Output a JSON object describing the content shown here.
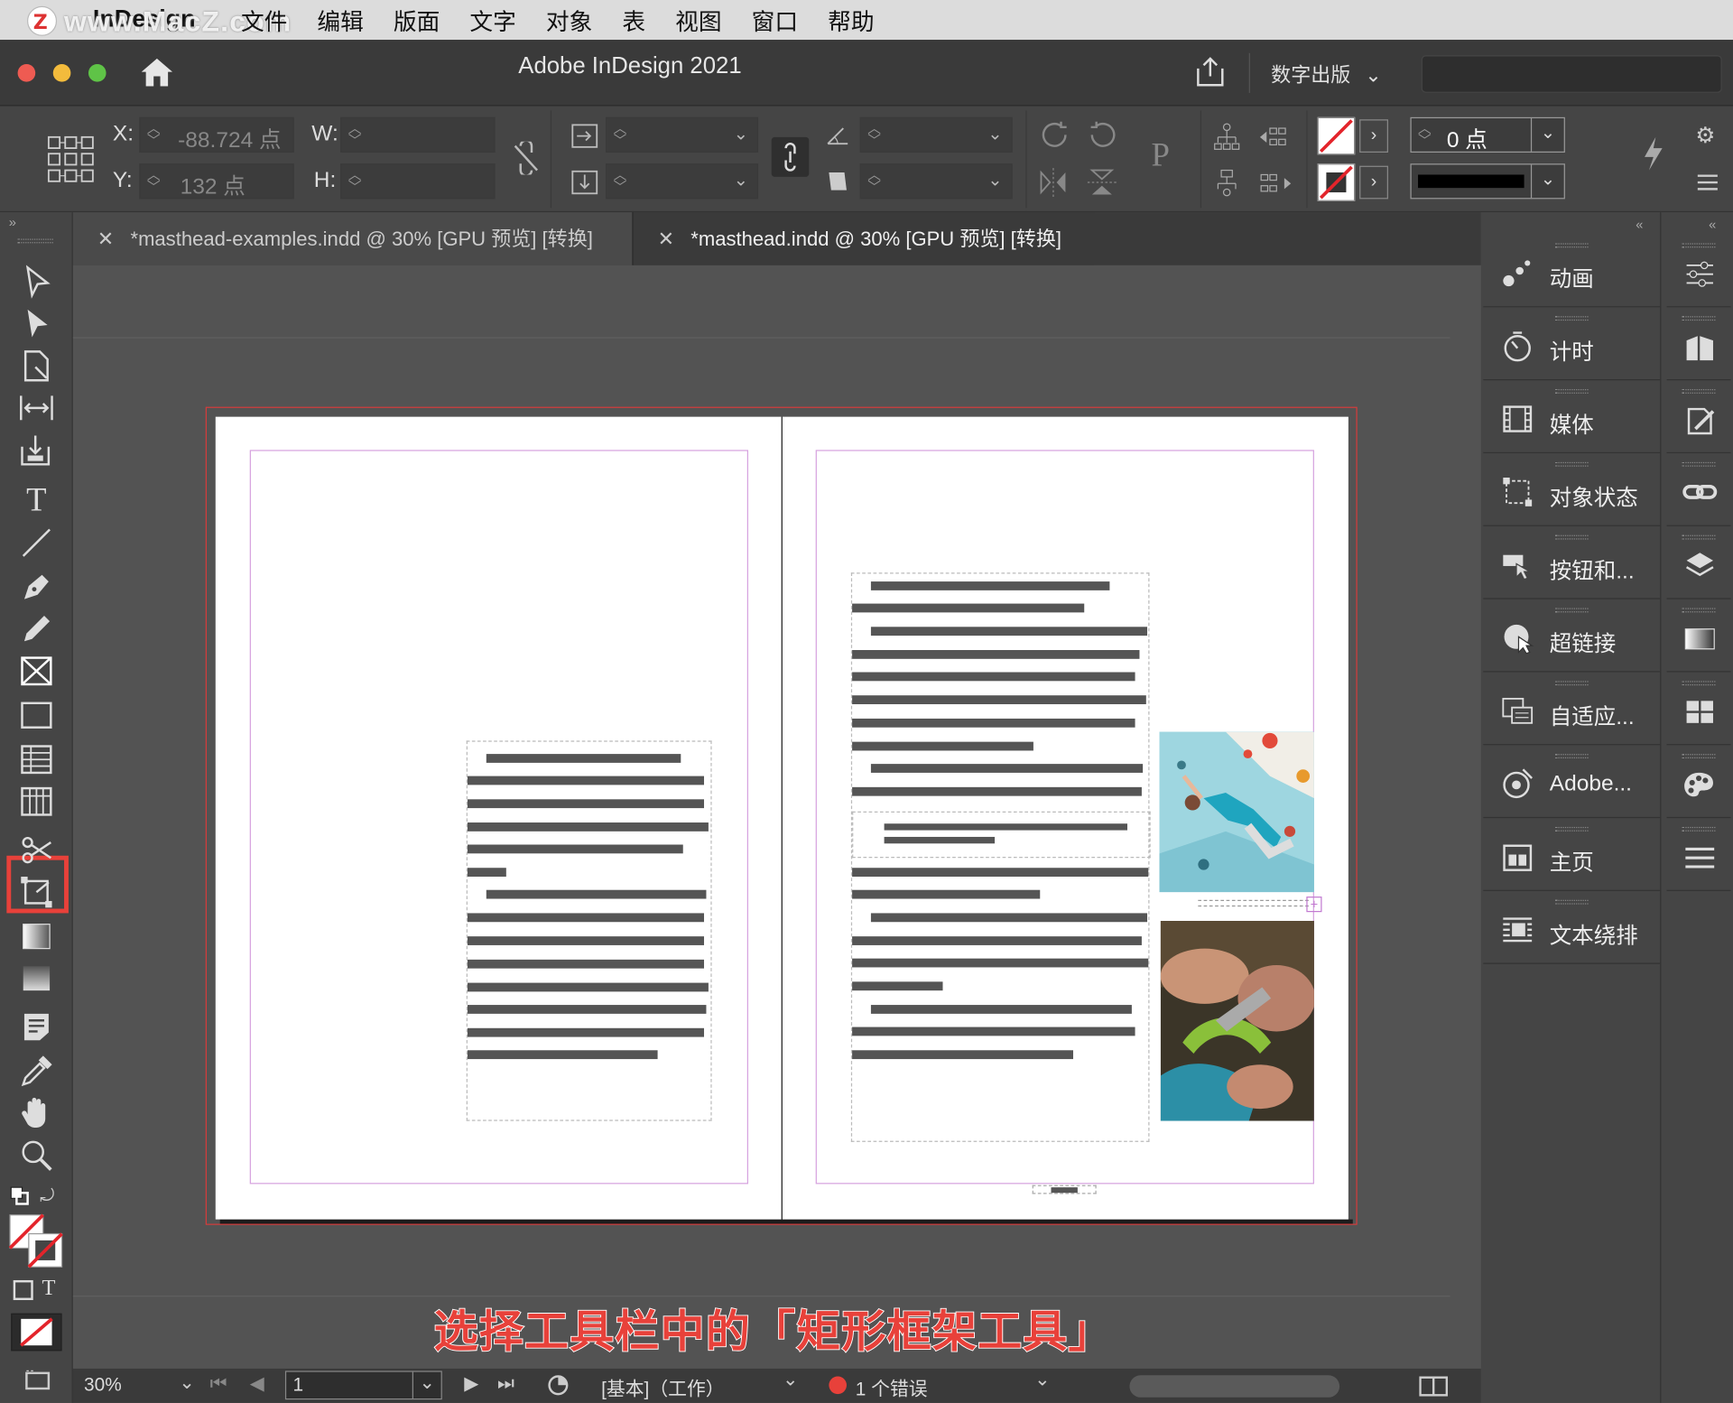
{
  "menubar": {
    "watermark": "www.MacZ.com",
    "app_name": "InDesign",
    "items": [
      "文件",
      "编辑",
      "版面",
      "文字",
      "对象",
      "表",
      "视图",
      "窗口",
      "帮助"
    ]
  },
  "titlebar": {
    "title": "Adobe InDesign 2021",
    "workspace": "数字出版"
  },
  "control": {
    "x_label": "X:",
    "y_label": "Y:",
    "w_label": "W:",
    "h_label": "H:",
    "x_value": "-88.724 点",
    "y_value": "132 点",
    "stroke_weight": "0 点"
  },
  "tabs": [
    {
      "label": "*masthead-examples.indd @ 30% [GPU 预览] [转换]"
    },
    {
      "label": "*masthead.indd @ 30% [GPU 预览] [转换]"
    }
  ],
  "panels": [
    {
      "label": "动画",
      "icon": "animation-icon"
    },
    {
      "label": "计时",
      "icon": "timer-icon"
    },
    {
      "label": "媒体",
      "icon": "media-icon"
    },
    {
      "label": "对象状态",
      "icon": "object-states-icon"
    },
    {
      "label": "按钮和...",
      "icon": "buttons-icon"
    },
    {
      "label": "超链接",
      "icon": "hyperlinks-icon"
    },
    {
      "label": "自适应...",
      "icon": "liquid-layout-icon"
    },
    {
      "label": "Adobe...",
      "icon": "adobe-color-icon"
    },
    {
      "label": "主页",
      "icon": "pages-icon"
    },
    {
      "label": "文本绕排",
      "icon": "text-wrap-icon"
    }
  ],
  "status": {
    "zoom": "30%",
    "page": "1",
    "preflight_profile": "[基本]（工作）",
    "errors": "1 个错误"
  },
  "caption": "选择工具栏中的「矩形框架工具」",
  "colors": {
    "highlight": "#e8413a",
    "error_dot": "#e8413a"
  }
}
